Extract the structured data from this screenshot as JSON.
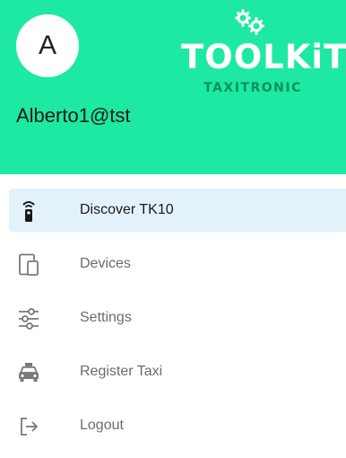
{
  "header": {
    "avatar_letter": "A",
    "user_email": "Alberto1@tst",
    "logo_title": "TOOLKiT",
    "logo_subtitle": "TAXITRONIC",
    "background_color": "#1de9a2"
  },
  "menu": {
    "items": [
      {
        "label": "Discover TK10",
        "icon": "remote-control-icon",
        "active": true
      },
      {
        "label": "Devices",
        "icon": "devices-icon",
        "active": false
      },
      {
        "label": "Settings",
        "icon": "sliders-icon",
        "active": false
      },
      {
        "label": "Register Taxi",
        "icon": "taxi-icon",
        "active": false
      },
      {
        "label": "Logout",
        "icon": "logout-icon",
        "active": false
      }
    ],
    "active_color": "#e3f1fb"
  }
}
